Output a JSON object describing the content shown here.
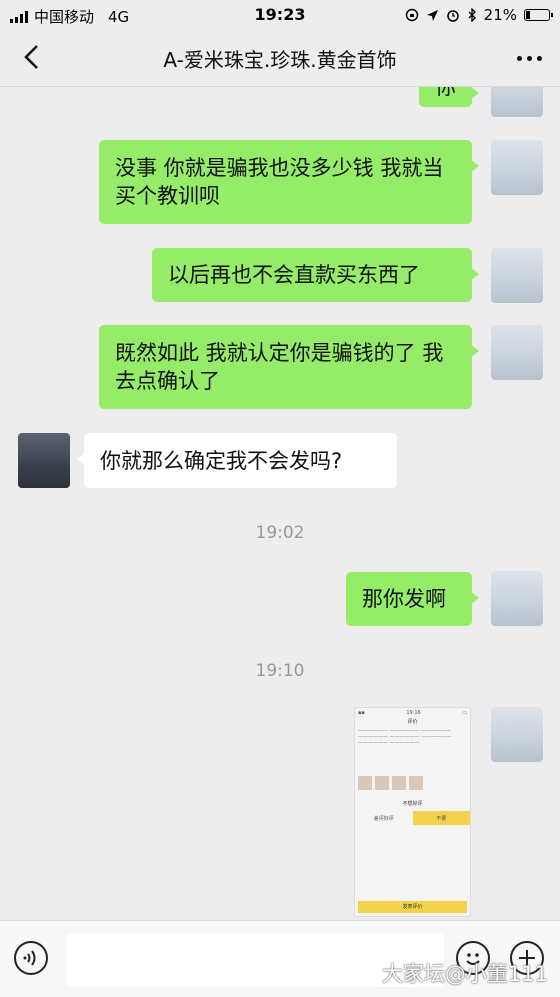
{
  "status_bar": {
    "carrier": "中国移动",
    "network": "4G",
    "time": "19:23",
    "battery": "21%",
    "battery_level": 0.21
  },
  "header": {
    "title": "A-爱米珠宝.珍珠.黄金首饰"
  },
  "messages": [
    {
      "from": "me",
      "text": "你"
    },
    {
      "from": "me",
      "text": "没事 你就是骗我也没多少钱 我就当买个教训呗"
    },
    {
      "from": "me",
      "text": "以后再也不会直款买东西了"
    },
    {
      "from": "me",
      "text": "既然如此 我就认定你是骗钱的了 我去点确认了"
    },
    {
      "from": "other",
      "text": "你就那么确定我不会发吗?"
    }
  ],
  "time_1902": "19:02",
  "msg_send": {
    "from": "me",
    "text": "那你发啊"
  },
  "time_1910": "19:10",
  "screenshot": {
    "time": "19:16",
    "title": "评价",
    "bad_label": "不想好评",
    "option_bad": "差评好评",
    "option_good": "不要",
    "button": "发表评价"
  },
  "watermark": "大家坛@小董111",
  "colors": {
    "me_bubble": "#95ec69",
    "other_bubble": "#ffffff",
    "background": "#ededed"
  }
}
